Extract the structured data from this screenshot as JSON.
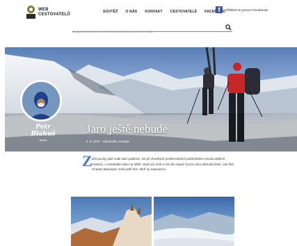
{
  "header": {
    "logo_line1": "WEB",
    "logo_line2": "CESTOVATELŮ",
    "nav": [
      "SOUTĚŽ",
      "O NÁS",
      "KONTAKT",
      "CESTOVATELÉ",
      "FACEBOOK"
    ],
    "facebook_label": "Přihlásit se pomocí Facebooku"
  },
  "search": {
    "placeholder": "Zadejte jméno země, pohoří nebo národní parku, či města"
  },
  "hero": {
    "author_name": "Petr Blahuš",
    "author_sub": "Bakalá",
    "title": "Jaro ještě nebude",
    "meta": "2. 3. 2017  ·  Slovensko, Evropa"
  },
  "article": {
    "dropcap": "Z",
    "text": "ažít pocity, jaké znali starí polárnici, lze při vhodných povětrnostních podmínkách mnoha dalších místech, v Antarktidě nebo na Sibiři. Stačí jen chtít a mít sílu nepeč trochu toho dobrodružství. Jak říká Charles Bukowski: Svět patří těm, kteří se neposerou."
  },
  "colors": {
    "accent": "#4a7bc8",
    "facebook": "#3b5998"
  }
}
